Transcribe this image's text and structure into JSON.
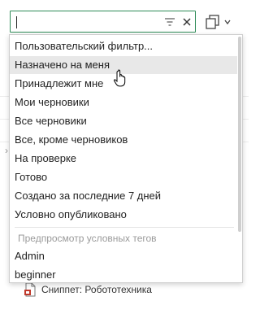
{
  "search": {
    "value": "",
    "placeholder": ""
  },
  "icons": {
    "filter": "filter-icon",
    "clear": "close-icon",
    "copy": "copy-icon",
    "chevron": "chevron-down-icon"
  },
  "colors": {
    "accent": "#2e8b57",
    "hover": "#e8e8e8",
    "section_text": "#9a9a9a"
  },
  "menu": {
    "items": [
      {
        "label": "Пользовательский фильтр..."
      },
      {
        "label": "Назначено на меня"
      },
      {
        "label": "Принадлежит мне"
      },
      {
        "label": "Мои черновики"
      },
      {
        "label": "Все черновики"
      },
      {
        "label": "Все, кроме черновиков"
      },
      {
        "label": "На проверке"
      },
      {
        "label": "Готово"
      },
      {
        "label": "Создано за последние 7 дней"
      },
      {
        "label": "Условно опубликовано"
      }
    ],
    "section_title": "Предпросмотр условных тегов",
    "tags": [
      {
        "label": "Admin"
      },
      {
        "label": "beginner"
      }
    ]
  },
  "background": {
    "item_label": "Сниппет: Робототехника"
  }
}
